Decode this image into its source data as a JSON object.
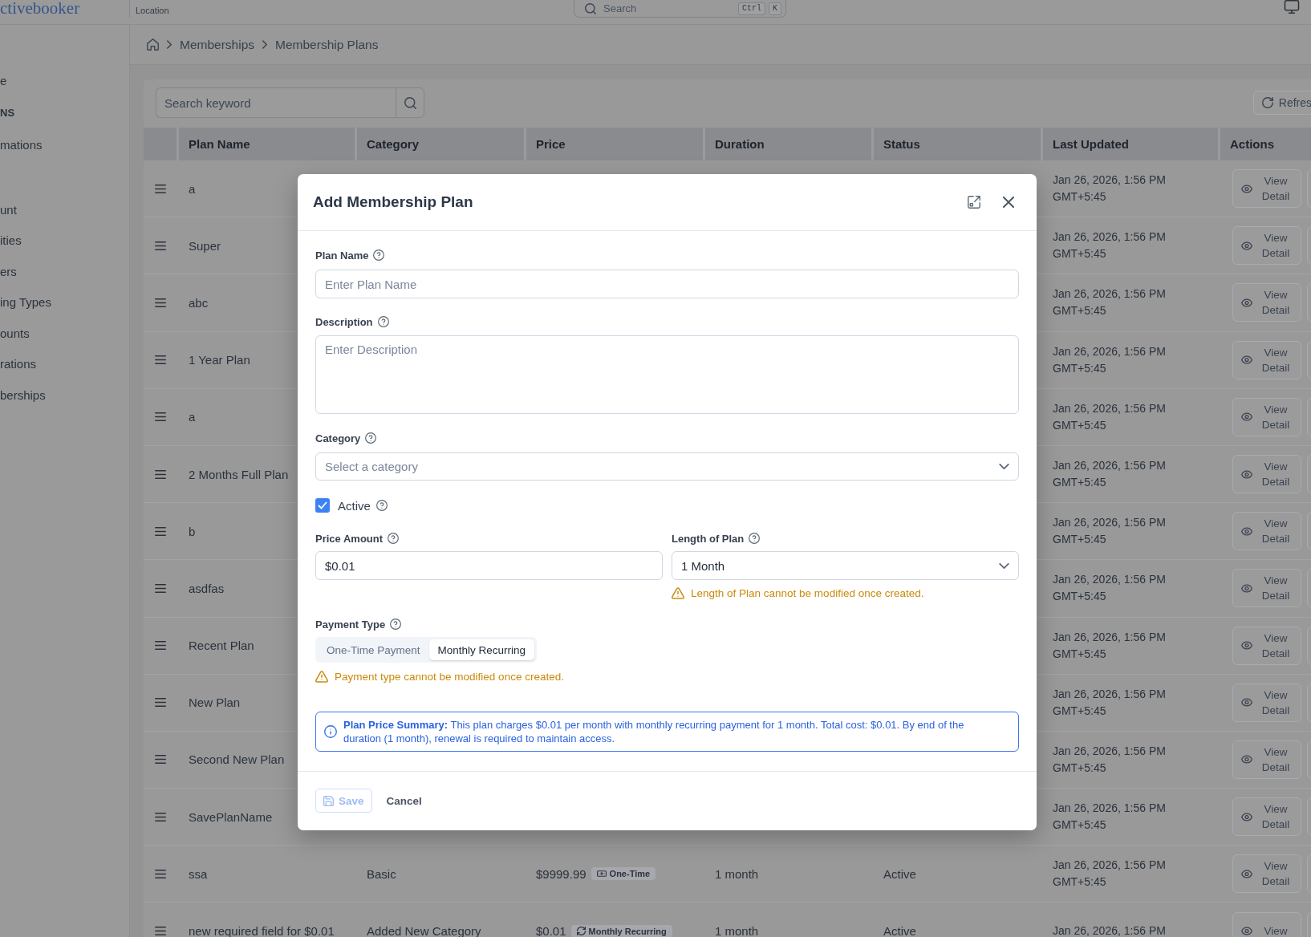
{
  "header": {
    "logo": "ctivebooker",
    "location_label": "Location",
    "search": {
      "placeholder": "Search",
      "shortcut_keys": [
        "Ctrl",
        "K"
      ]
    }
  },
  "sidebar": {
    "sections": [
      {
        "items": [
          "e"
        ]
      },
      {
        "title": "NS",
        "items": [
          "mations"
        ]
      },
      {
        "items": [
          "unt",
          "ities",
          "ers",
          "ing Types",
          "ounts",
          "rations",
          "berships"
        ]
      }
    ]
  },
  "breadcrumb": [
    "Memberships",
    "Membership Plans"
  ],
  "toolbar": {
    "search": {
      "placeholder": "Search keyword"
    },
    "refresh_button": "Refres"
  },
  "table": {
    "columns": [
      "Plan Name",
      "Category",
      "Price",
      "Duration",
      "Status",
      "Last Updated",
      "Actions"
    ],
    "rows": [
      {
        "plan_name": "a",
        "last_updated": "Jan 26, 2026, 1:56 PM GMT+5:45",
        "action": "View Detail"
      },
      {
        "plan_name": "Super",
        "last_updated": "Jan 26, 2026, 1:56 PM GMT+5:45",
        "action": "View Detail"
      },
      {
        "plan_name": "abc",
        "last_updated": "Jan 26, 2026, 1:56 PM GMT+5:45",
        "action": "View Detail"
      },
      {
        "plan_name": "1 Year Plan",
        "last_updated": "Jan 26, 2026, 1:56 PM GMT+5:45",
        "action": "View Detail"
      },
      {
        "plan_name": "a",
        "last_updated": "Jan 26, 2026, 1:56 PM GMT+5:45",
        "action": "View Detail"
      },
      {
        "plan_name": "2 Months Full Plan",
        "last_updated": "Jan 26, 2026, 1:56 PM GMT+5:45",
        "action": "View Detail"
      },
      {
        "plan_name": "b",
        "last_updated": "Jan 26, 2026, 1:56 PM GMT+5:45",
        "action": "View Detail"
      },
      {
        "plan_name": "asdfas",
        "last_updated": "Jan 26, 2026, 1:56 PM GMT+5:45",
        "action": "View Detail"
      },
      {
        "plan_name": "Recent Plan",
        "last_updated": "Jan 26, 2026, 1:56 PM GMT+5:45",
        "action": "View Detail"
      },
      {
        "plan_name": "New Plan",
        "last_updated": "Jan 26, 2026, 1:56 PM GMT+5:45",
        "action": "View Detail"
      },
      {
        "plan_name": "Second New Plan",
        "last_updated": "Jan 26, 2026, 1:56 PM GMT+5:45",
        "action": "View Detail"
      },
      {
        "plan_name": "SavePlanName",
        "last_updated": "Jan 26, 2026, 1:56 PM GMT+5:45",
        "action": "View Detail"
      },
      {
        "plan_name": "ssa",
        "category": "Basic",
        "price": "$9999.99",
        "payment_badge": {
          "label": "One-Time",
          "kind": "one_time"
        },
        "duration": "1 month",
        "status": "Active",
        "last_updated": "Jan 26, 2026, 1:56 PM GMT+5:45",
        "action": "View Detail"
      },
      {
        "plan_name": "new required field for $0.01",
        "category": "Added New Category",
        "price": "$0.01",
        "payment_badge": {
          "label": "Monthly Recurring",
          "kind": "recurring"
        },
        "duration": "1 month",
        "status": "Active",
        "last_updated": "Jan 26, 2026, 1:56 PM",
        "action": "View"
      }
    ]
  },
  "dialog": {
    "title": "Add Membership Plan",
    "plan_name": {
      "label": "Plan Name",
      "placeholder": "Enter Plan Name"
    },
    "description": {
      "label": "Description",
      "placeholder": "Enter Description"
    },
    "category": {
      "label": "Category",
      "placeholder": "Select a category"
    },
    "active": {
      "label": "Active",
      "checked": true
    },
    "price_amount": {
      "label": "Price Amount",
      "value": "$0.01"
    },
    "length_of_plan": {
      "label": "Length of Plan",
      "value": "1 Month",
      "warning": "Length of Plan cannot be modified once created."
    },
    "payment_type": {
      "label": "Payment Type",
      "options": [
        {
          "label": "One-Time Payment",
          "selected": false
        },
        {
          "label": "Monthly Recurring",
          "selected": true
        }
      ],
      "warning": "Payment type cannot be modified once created."
    },
    "summary": "**Plan Price Summary:** This plan charges $0.01 per month with monthly recurring payment for 1 month. Total cost: $0.01. By end of the duration (1 month), renewal is required to maintain access.",
    "buttons": [
      {
        "label": "Save",
        "kind": "primary",
        "disabled": true
      },
      {
        "label": "Cancel",
        "kind": "text",
        "disabled": false
      }
    ]
  }
}
